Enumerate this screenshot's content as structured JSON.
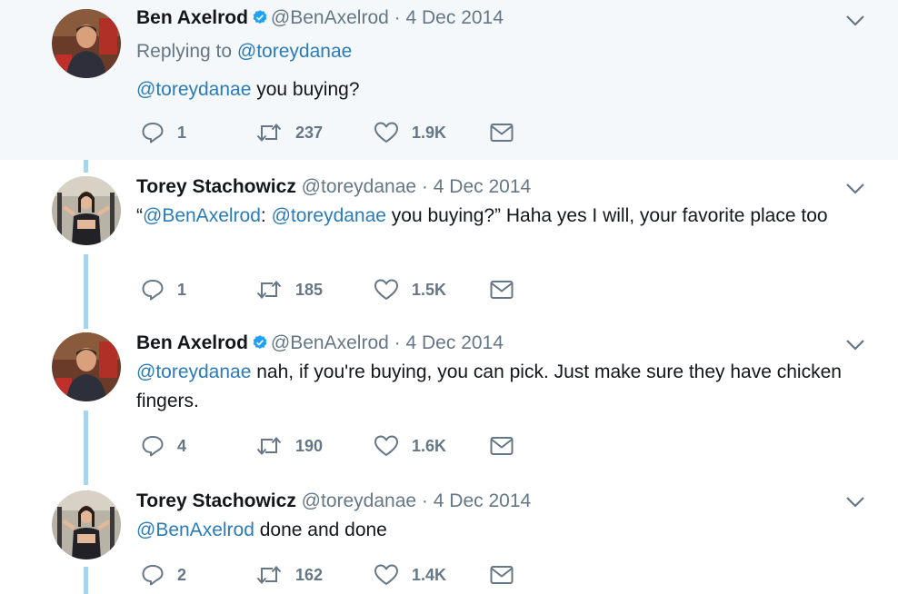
{
  "tweets": [
    {
      "name": "Ben Axelrod",
      "verified": true,
      "handle": "@BenAxelrod",
      "dot": "·",
      "date": "4 Dec 2014",
      "replying_prefix": "Replying to",
      "replying_to": "@toreydanae",
      "mention": "@toreydanae",
      "text": " you buying?",
      "replies": "1",
      "retweets": "237",
      "likes": "1.9K"
    },
    {
      "name": "Torey Stachowicz",
      "verified": false,
      "handle": "@toreydanae",
      "dot": "·",
      "date": "4 Dec 2014",
      "quote_open": "“",
      "mention1": "@BenAxelrod",
      "colon": ": ",
      "mention2": "@toreydanae",
      "text": " you buying?” Haha yes I will, your favorite place too",
      "replies": "1",
      "retweets": "185",
      "likes": "1.5K"
    },
    {
      "name": "Ben Axelrod",
      "verified": true,
      "handle": "@BenAxelrod",
      "dot": "·",
      "date": "4 Dec 2014",
      "mention": "@toreydanae",
      "text": " nah, if you're buying, you can pick. Just make sure they have chicken fingers.",
      "replies": "4",
      "retweets": "190",
      "likes": "1.6K"
    },
    {
      "name": "Torey Stachowicz",
      "verified": false,
      "handle": "@toreydanae",
      "dot": "·",
      "date": "4 Dec 2014",
      "mention": "@BenAxelrod",
      "text": " done and done",
      "replies": "2",
      "retweets": "162",
      "likes": "1.4K"
    }
  ],
  "icons": {
    "reply": "reply-icon",
    "retweet": "retweet-icon",
    "like": "heart-icon",
    "dm": "envelope-icon",
    "caret": "chevron-down-icon",
    "verified": "verified-badge-icon"
  },
  "colors": {
    "link": "#2b7bb9",
    "muted": "#657786",
    "thread_line": "#a6d5ec",
    "verified": "#1da1f2",
    "highlight_bg": "#f5f8fa"
  }
}
